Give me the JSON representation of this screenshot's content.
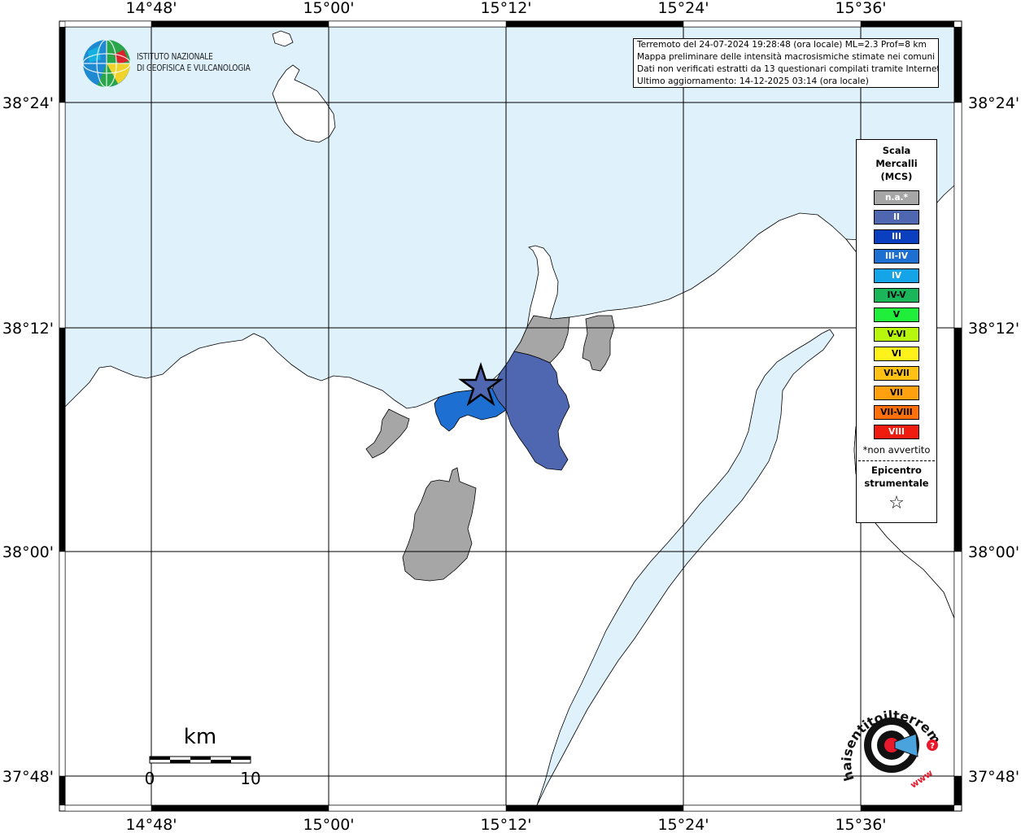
{
  "map": {
    "lon_labels": [
      "14°48'",
      "15°00'",
      "15°12'",
      "15°24'",
      "15°36'"
    ],
    "lat_labels": [
      "38°24'",
      "38°12'",
      "38°00'",
      "37°48'"
    ],
    "colors": {
      "sea": "#dff1fb",
      "land": "#ffffff",
      "not_felt": "#a6a6a6",
      "intensity_II": "#4f67b0",
      "intensity_III_IV": "#1d6fd1"
    },
    "epicenter_symbol": "star"
  },
  "info": {
    "line1": "Terremoto del 24-07-2024 19:28:48 (ora locale) ML=2.3 Prof=8 km",
    "line2": "Mappa preliminare delle intensità macrosismiche stimate nei comuni",
    "line3": "Dati non verificati estratti da 13 questionari compilati tramite Internet.",
    "line4": "Ultimo aggiornamento: 14-12-2025 03:14 (ora locale)"
  },
  "logo": {
    "line1": "ISTITUTO NAZIONALE",
    "line2": "DI GEOFISICA E VULCANOLOGIA"
  },
  "legend": {
    "title1": "Scala",
    "title2": "Mercalli",
    "title3": "(MCS)",
    "items": [
      {
        "label": "n.a.*",
        "color": "#a6a6a6",
        "text_color": "#ffffff"
      },
      {
        "label": "II",
        "color": "#4f67b0",
        "text_color": "#ffffff"
      },
      {
        "label": "III",
        "color": "#0a3fbf",
        "text_color": "#ffffff"
      },
      {
        "label": "III-IV",
        "color": "#1d6fd1",
        "text_color": "#ffffff"
      },
      {
        "label": "IV",
        "color": "#16a4e8",
        "text_color": "#ffffff"
      },
      {
        "label": "IV-V",
        "color": "#1bb55a",
        "text_color": "#000000"
      },
      {
        "label": "V",
        "color": "#1fef3b",
        "text_color": "#000000"
      },
      {
        "label": "V-VI",
        "color": "#b9f60e",
        "text_color": "#000000"
      },
      {
        "label": "VI",
        "color": "#fff21a",
        "text_color": "#000000"
      },
      {
        "label": "VI-VII",
        "color": "#ffc114",
        "text_color": "#000000"
      },
      {
        "label": "VII",
        "color": "#ffa10e",
        "text_color": "#000000"
      },
      {
        "label": "VII-VIII",
        "color": "#ff700b",
        "text_color": "#000000"
      },
      {
        "label": "VIII",
        "color": "#f01c10",
        "text_color": "#ffffff"
      }
    ],
    "note": "*non avvertito",
    "epicenter1": "Epicentro",
    "epicenter2": "strumentale",
    "epicenter_symbol": "☆"
  },
  "scale": {
    "unit": "km",
    "min": "0",
    "max": "10"
  },
  "hst_logo": {
    "text": "haisentitoilterremoto.it",
    "url_text": "www"
  }
}
